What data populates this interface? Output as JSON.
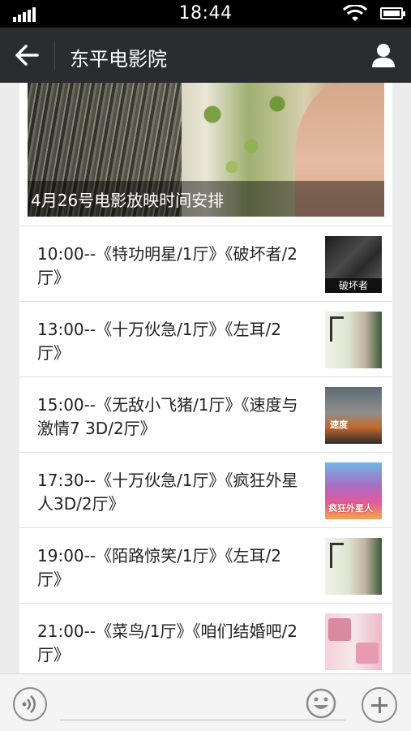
{
  "status": {
    "time": "18:44"
  },
  "header": {
    "title": "东平电影院"
  },
  "banner": {
    "caption": "4月26号电影放映时间安排"
  },
  "schedule": [
    {
      "text": "10:00--《特功明星/1厅》《破坏者/2厅》",
      "thumb_label": "破坏者"
    },
    {
      "text": "13:00--《十万伙急/1厅》《左耳/2厅》"
    },
    {
      "text": "15:00--《无敌小飞猪/1厅》《速度与激情7 3D/2厅》",
      "thumb_label": "速度"
    },
    {
      "text": "17:30--《十万伙急/1厅》《疯狂外星人3D/2厅》",
      "thumb_label": "疯狂外星人"
    },
    {
      "text": "19:00--《陌路惊笑/1厅》《左耳/2厅》"
    },
    {
      "text": "21:00--《菜鸟/1厅》《咱们结婚吧/2厅》"
    }
  ],
  "icons": {
    "back": "arrow-left-icon",
    "user": "user-icon",
    "voice": "voice-icon",
    "emoji": "emoji-icon",
    "plus": "plus-icon"
  },
  "colors": {
    "navbar": "#2a2d2f",
    "statusbar": "#000000",
    "page_bg": "#ececec"
  }
}
